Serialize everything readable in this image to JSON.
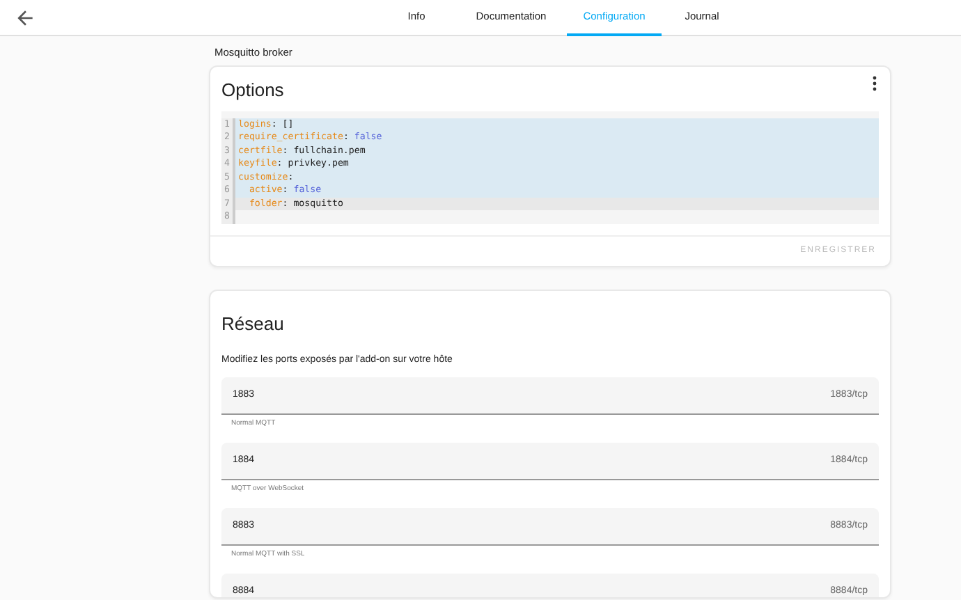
{
  "tabs": [
    {
      "label": "Info",
      "selected": false
    },
    {
      "label": "Documentation",
      "selected": false
    },
    {
      "label": "Configuration",
      "selected": true
    },
    {
      "label": "Journal",
      "selected": false
    }
  ],
  "addon_name": "Mosquitto broker",
  "options_card": {
    "title": "Options",
    "editor": {
      "lines": [
        {
          "number": "1",
          "selected": true,
          "active": false,
          "tokens": [
            {
              "kind": "key",
              "text": "logins"
            },
            {
              "kind": "plain",
              "text": ": []"
            }
          ]
        },
        {
          "number": "2",
          "selected": true,
          "active": false,
          "tokens": [
            {
              "kind": "key",
              "text": "require_certificate"
            },
            {
              "kind": "plain",
              "text": ": "
            },
            {
              "kind": "bool",
              "text": "false"
            }
          ]
        },
        {
          "number": "3",
          "selected": true,
          "active": false,
          "tokens": [
            {
              "kind": "key",
              "text": "certfile"
            },
            {
              "kind": "plain",
              "text": ": fullchain.pem"
            }
          ]
        },
        {
          "number": "4",
          "selected": true,
          "active": false,
          "tokens": [
            {
              "kind": "key",
              "text": "keyfile"
            },
            {
              "kind": "plain",
              "text": ": privkey.pem"
            }
          ]
        },
        {
          "number": "5",
          "selected": true,
          "active": false,
          "tokens": [
            {
              "kind": "key",
              "text": "customize"
            },
            {
              "kind": "plain",
              "text": ":"
            }
          ]
        },
        {
          "number": "6",
          "selected": true,
          "active": false,
          "tokens": [
            {
              "kind": "key",
              "text": "  active"
            },
            {
              "kind": "plain",
              "text": ": "
            },
            {
              "kind": "bool",
              "text": "false"
            }
          ]
        },
        {
          "number": "7",
          "selected": false,
          "active": true,
          "tokens": [
            {
              "kind": "key",
              "text": "  folder"
            },
            {
              "kind": "plain",
              "text": ": mosquitto"
            }
          ]
        },
        {
          "number": "8",
          "selected": false,
          "active": false
        }
      ]
    },
    "save_button": {
      "label": "ENREGISTRER",
      "disabled": true
    }
  },
  "network_card": {
    "title": "Réseau",
    "description": "Modifiez les ports exposés par l'add-on sur votre hôte",
    "ports": [
      {
        "value": "1883",
        "suffix": "1883/tcp",
        "helper": "Normal MQTT"
      },
      {
        "value": "1884",
        "suffix": "1884/tcp",
        "helper": "MQTT over WebSocket"
      },
      {
        "value": "8883",
        "suffix": "8883/tcp",
        "helper": "Normal MQTT with SSL"
      },
      {
        "value": "8884",
        "suffix": "8884/tcp"
      }
    ]
  }
}
